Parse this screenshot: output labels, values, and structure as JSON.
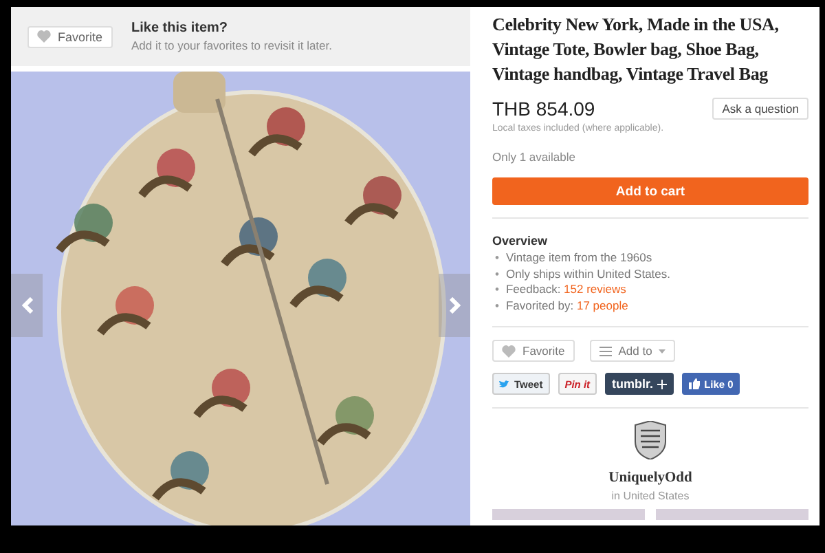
{
  "favorite_banner": {
    "button": "Favorite",
    "title": "Like this item?",
    "subtitle": "Add it to your favorites to revisit it later."
  },
  "listing": {
    "title": "Celebrity New York, Made in the USA, Vintage Tote, Bowler bag, Shoe Bag, Vintage handbag, Vintage Travel Bag",
    "price": "THB 854.09",
    "ask_button": "Ask a question",
    "tax_note": "Local taxes included (where applicable).",
    "availability": "Only 1 available",
    "add_to_cart": "Add to cart"
  },
  "overview": {
    "heading": "Overview",
    "items": [
      {
        "marker": "•",
        "text": "Vintage item from the 1960s"
      },
      {
        "marker": "•",
        "text": "Only ships within United States."
      },
      {
        "marker": "•",
        "text": "Feedback: ",
        "link": "152 reviews"
      },
      {
        "marker": "•",
        "text": "Favorited by: ",
        "link": "17 people"
      }
    ]
  },
  "actions": {
    "favorite": "Favorite",
    "add_to": "Add to"
  },
  "share": [
    {
      "kind": "twitter",
      "label": "Tweet"
    },
    {
      "kind": "pinterest",
      "label": "Pin it"
    },
    {
      "kind": "tumblr",
      "label": "tumblr."
    },
    {
      "kind": "facebook",
      "label": "Like 0"
    }
  ],
  "shop": {
    "name": "UniquelyOdd",
    "location": "in United States"
  }
}
